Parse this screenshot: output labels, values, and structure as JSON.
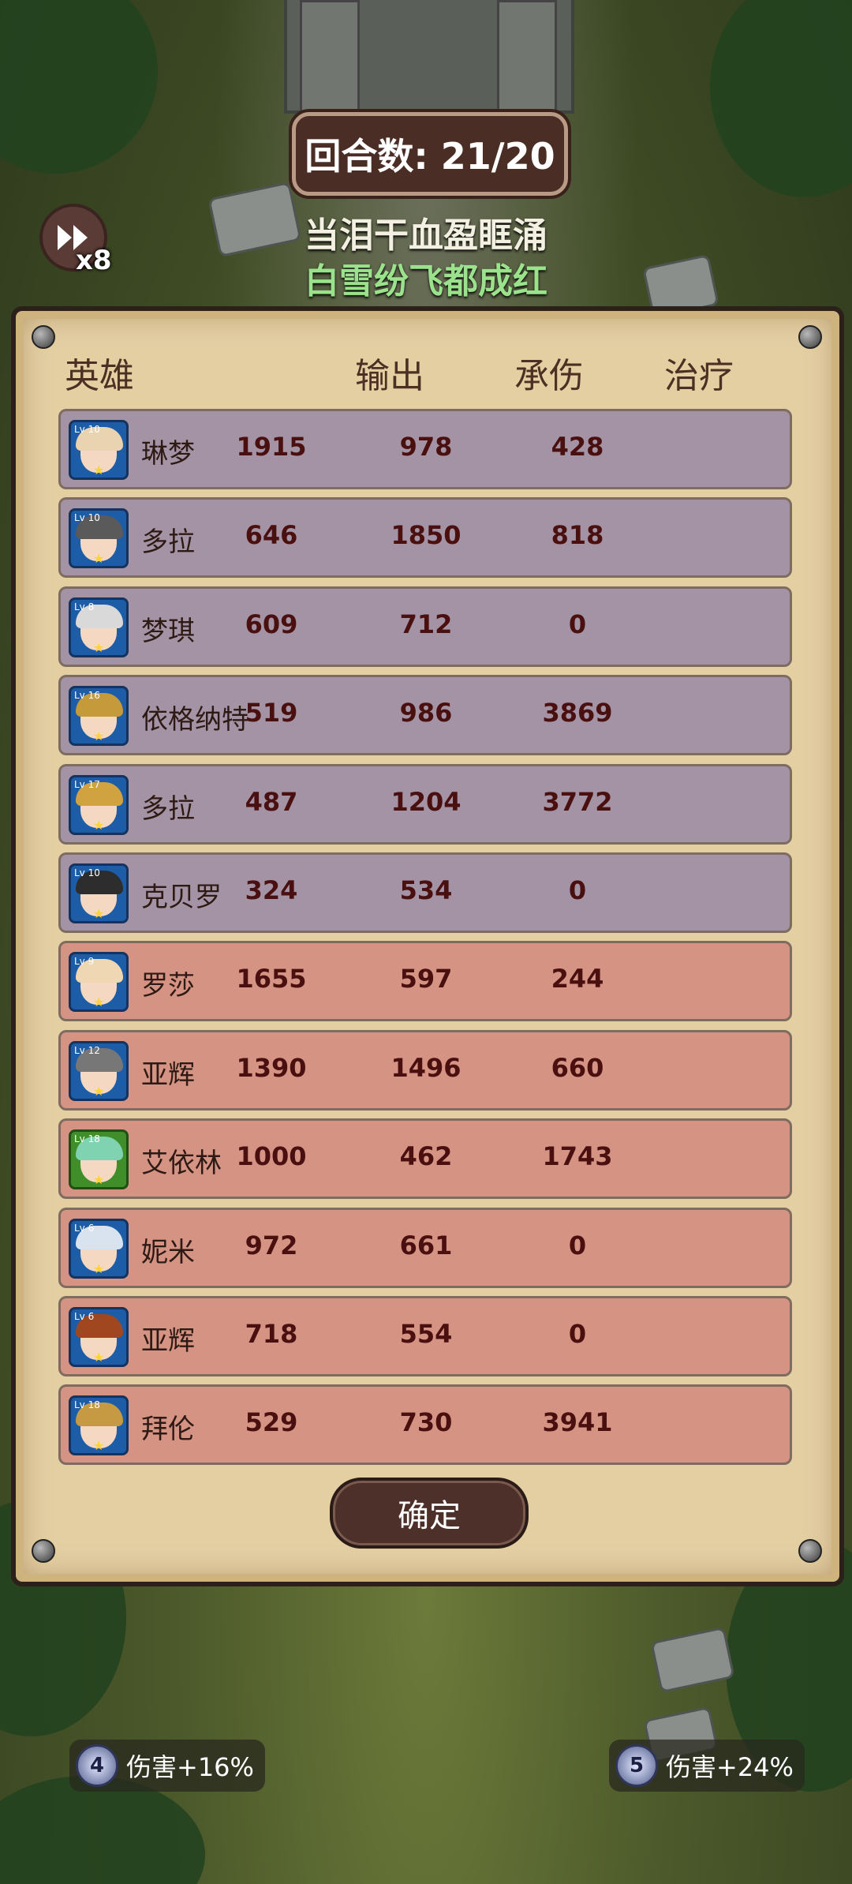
{
  "hud": {
    "round_label": "回合数: 21/20",
    "speed_multiplier": "x8",
    "quote_line1": "当泪干血盈眶涌",
    "quote_line2": "白雪纷飞都成红"
  },
  "table": {
    "headers": {
      "hero": "英雄",
      "output": "输出",
      "tank": "承伤",
      "heal": "治疗"
    },
    "rows": [
      {
        "team": "blue",
        "name": "琳梦",
        "level": "Lv 10",
        "output": "1915",
        "tank": "978",
        "heal": "428"
      },
      {
        "team": "blue",
        "name": "多拉",
        "level": "Lv 10",
        "output": "646",
        "tank": "1850",
        "heal": "818"
      },
      {
        "team": "blue",
        "name": "梦琪",
        "level": "Lv 8",
        "output": "609",
        "tank": "712",
        "heal": "0"
      },
      {
        "team": "blue",
        "name": "依格纳特",
        "level": "Lv 16",
        "output": "519",
        "tank": "986",
        "heal": "3869"
      },
      {
        "team": "blue",
        "name": "多拉",
        "level": "Lv 17",
        "output": "487",
        "tank": "1204",
        "heal": "3772"
      },
      {
        "team": "blue",
        "name": "克贝罗",
        "level": "Lv 10",
        "output": "324",
        "tank": "534",
        "heal": "0"
      },
      {
        "team": "red",
        "name": "罗莎",
        "level": "Lv 9",
        "output": "1655",
        "tank": "597",
        "heal": "244"
      },
      {
        "team": "red",
        "name": "亚辉",
        "level": "Lv 12",
        "output": "1390",
        "tank": "1496",
        "heal": "660"
      },
      {
        "team": "red",
        "name": "艾依林",
        "level": "Lv 18",
        "output": "1000",
        "tank": "462",
        "heal": "1743"
      },
      {
        "team": "red",
        "name": "妮米",
        "level": "Lv 6",
        "output": "972",
        "tank": "661",
        "heal": "0"
      },
      {
        "team": "red",
        "name": "亚辉",
        "level": "Lv 6",
        "output": "718",
        "tank": "554",
        "heal": "0"
      },
      {
        "team": "red",
        "name": "拜伦",
        "level": "Lv 18",
        "output": "529",
        "tank": "730",
        "heal": "3941"
      }
    ]
  },
  "confirm_label": "确定",
  "buffs": {
    "left": {
      "stack": "4",
      "text": "伤害+16%"
    },
    "right": {
      "stack": "5",
      "text": "伤害+24%"
    }
  },
  "colors": {
    "blue_row": "#a393a5",
    "red_row": "#d59383",
    "quote2": "#9be28c"
  }
}
